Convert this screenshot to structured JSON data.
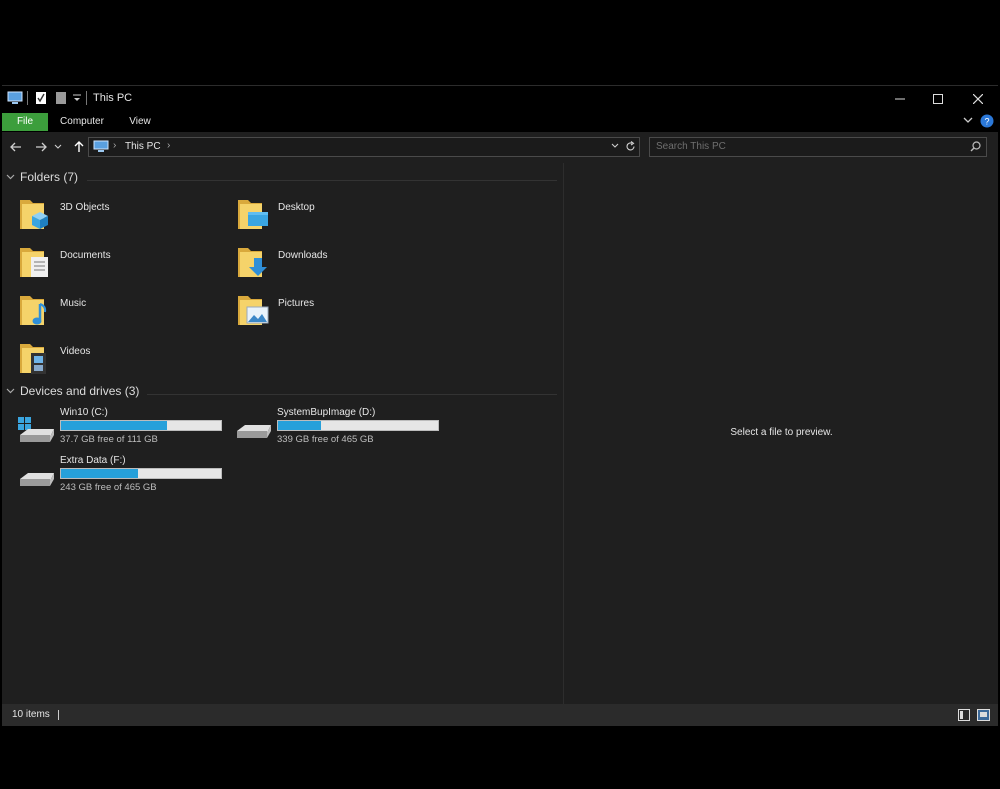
{
  "window": {
    "title": "This PC"
  },
  "ribbon": {
    "tabs": [
      {
        "label": "File"
      },
      {
        "label": "Computer"
      },
      {
        "label": "View"
      }
    ]
  },
  "nav": {
    "breadcrumb": "This PC",
    "search_placeholder": "Search This PC"
  },
  "folders": {
    "header": "Folders (7)",
    "items": [
      {
        "label": "3D Objects",
        "icon": "3d-objects-folder-icon"
      },
      {
        "label": "Desktop",
        "icon": "desktop-folder-icon"
      },
      {
        "label": "Documents",
        "icon": "documents-folder-icon"
      },
      {
        "label": "Downloads",
        "icon": "downloads-folder-icon"
      },
      {
        "label": "Music",
        "icon": "music-folder-icon"
      },
      {
        "label": "Pictures",
        "icon": "pictures-folder-icon"
      },
      {
        "label": "Videos",
        "icon": "videos-folder-icon"
      }
    ]
  },
  "drives": {
    "header": "Devices and drives (3)",
    "items": [
      {
        "name": "Win10 (C:)",
        "free": "37.7 GB free of 111 GB",
        "used_fraction": 0.66,
        "icon": "windows-drive-icon"
      },
      {
        "name": "SystemBupImage (D:)",
        "free": "339 GB free of 465 GB",
        "used_fraction": 0.27,
        "icon": "hard-drive-icon"
      },
      {
        "name": "Extra Data (F:)",
        "free": "243 GB free of 465 GB",
        "used_fraction": 0.48,
        "icon": "hard-drive-icon"
      }
    ]
  },
  "preview": {
    "text": "Select a file to preview."
  },
  "status": {
    "items_count": "10 items"
  },
  "colors": {
    "accent_file_tab": "#3c9e3c",
    "drive_fill": "#26a0da",
    "background": "#1f1f1f"
  }
}
